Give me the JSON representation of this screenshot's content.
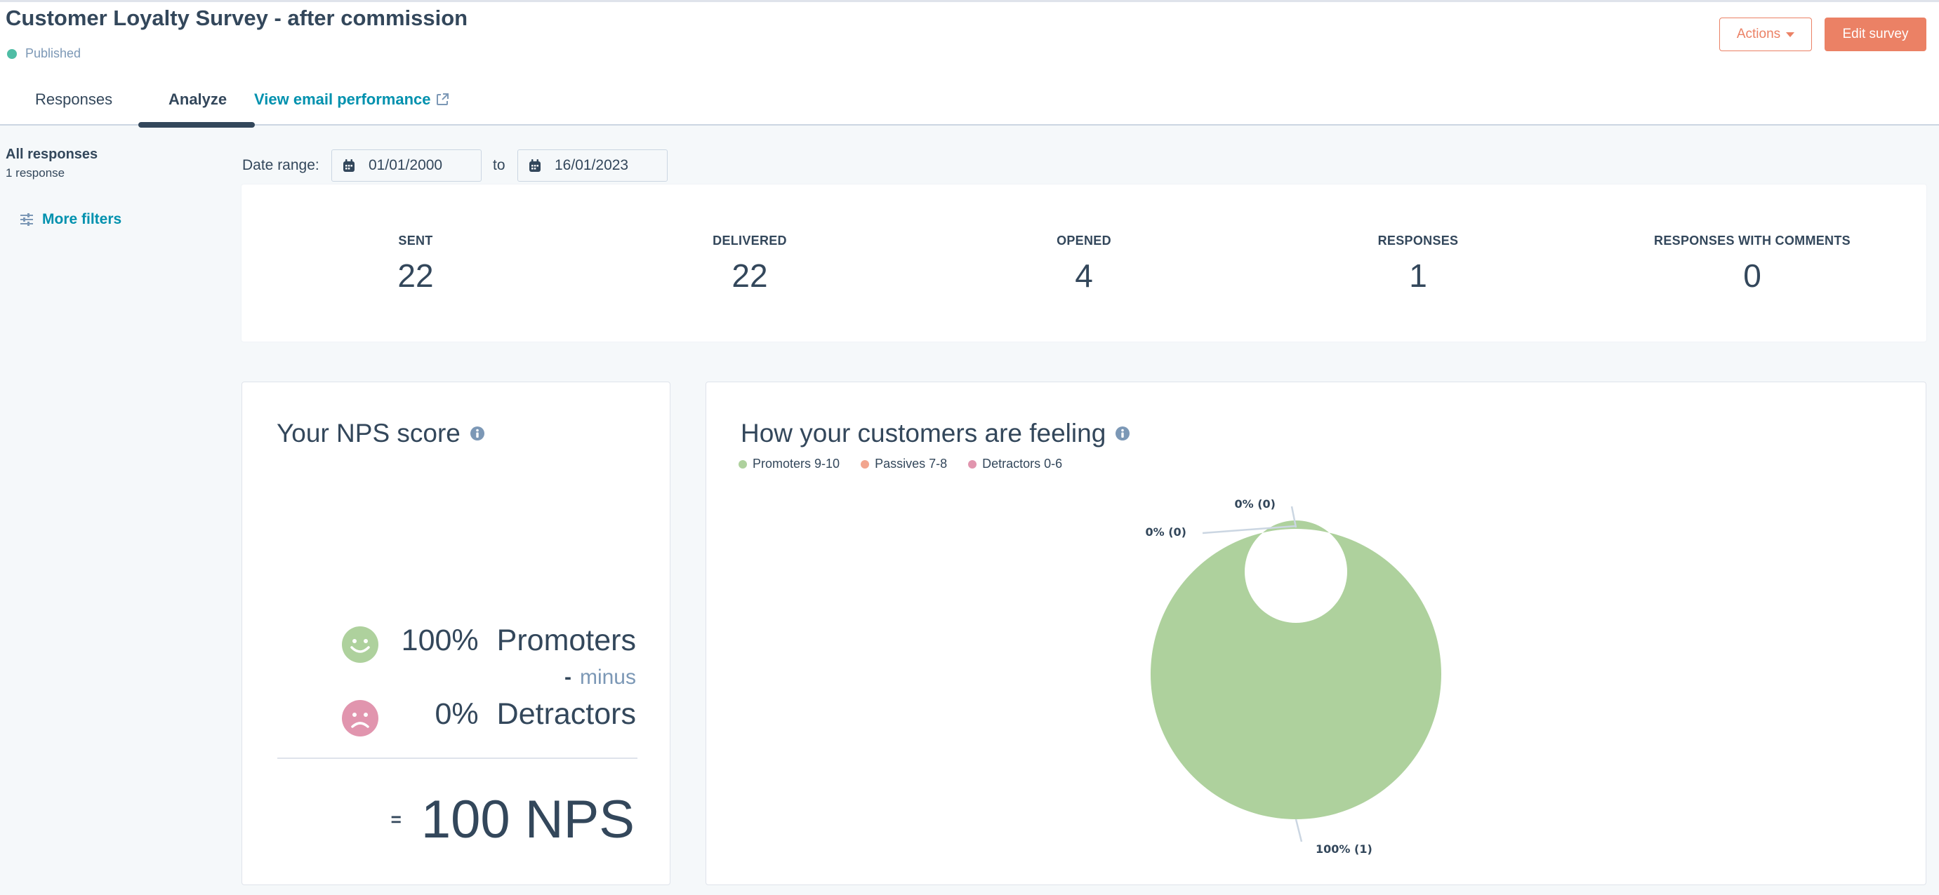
{
  "header": {
    "title": "Customer Loyalty Survey - after commission",
    "status": "Published",
    "status_color": "#4fbda5",
    "actions_label": "Actions",
    "edit_label": "Edit survey",
    "accent_color": "#eb8165"
  },
  "tabs": [
    {
      "label": "Responses",
      "active": false
    },
    {
      "label": "Analyze",
      "active": true
    },
    {
      "label": "View email performance",
      "external": true
    }
  ],
  "sidebar": {
    "title": "All responses",
    "subtitle": "1 response",
    "filters_label": "More filters"
  },
  "date_range": {
    "label": "Date range:",
    "from": "01/01/2000",
    "separator": "to",
    "to": "16/01/2023"
  },
  "stats": [
    {
      "label": "SENT",
      "value": "22"
    },
    {
      "label": "DELIVERED",
      "value": "22"
    },
    {
      "label": "OPENED",
      "value": "4"
    },
    {
      "label": "RESPONSES",
      "value": "1"
    },
    {
      "label": "RESPONSES WITH COMMENTS",
      "value": "0"
    }
  ],
  "nps": {
    "title": "Your NPS score",
    "promoters_pct": "100%",
    "promoters_label": "Promoters",
    "minus_dash": "-",
    "minus_label": "minus",
    "detractors_pct": "0%",
    "detractors_label": "Detractors",
    "equals": "=",
    "score": "100 NPS"
  },
  "feeling": {
    "title": "How your customers are feeling"
  },
  "chart_data": {
    "type": "pie",
    "variant": "donut",
    "title": "How your customers are feeling",
    "legend_position": "top-left",
    "categories": [
      "Promoters 9-10",
      "Passives 7-8",
      "Detractors 0-6"
    ],
    "values": [
      1,
      0,
      0
    ],
    "percentages": [
      100,
      0,
      0
    ],
    "colors": [
      "#aed19d",
      "#f2a58e",
      "#e195ae"
    ],
    "data_labels": [
      "100% (1)",
      "0% (0)",
      "0% (0)"
    ]
  }
}
